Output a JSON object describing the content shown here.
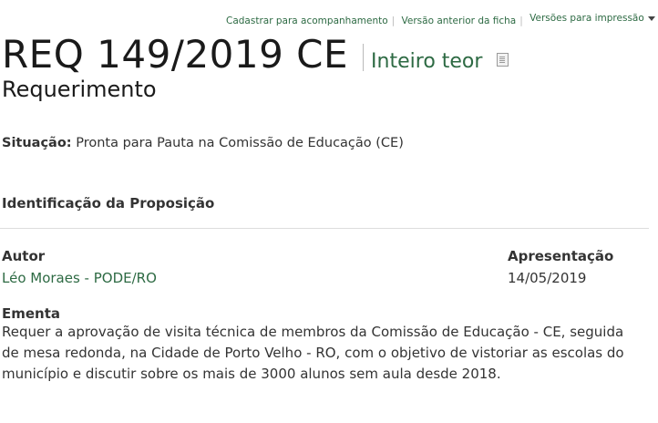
{
  "toplinks": {
    "cadastrar": "Cadastrar para acompanhamento",
    "versao_anterior": "Versão anterior da ficha",
    "versoes_impressao": "Versões para impressão"
  },
  "header": {
    "title": "REQ 149/2019 CE",
    "inteiro_teor": "Inteiro teor",
    "subtitle": "Requerimento"
  },
  "situacao": {
    "label": "Situação:",
    "value": "Pronta para Pauta na Comissão de Educação (CE)"
  },
  "identificacao": {
    "heading": "Identificação da Proposição"
  },
  "autor": {
    "label": "Autor",
    "value": "Léo Moraes - PODE/RO"
  },
  "apresentacao": {
    "label": "Apresentação",
    "value": "14/05/2019"
  },
  "ementa": {
    "label": "Ementa",
    "value": "Requer a aprovação de visita técnica de membros da Comissão de Educação - CE, seguida de mesa redonda, na Cidade de Porto Velho - RO, com o objetivo de vistoriar as escolas do município e discutir sobre os mais de 3000 alunos sem aula desde 2018."
  },
  "colors": {
    "link": "#2d6a43",
    "text": "#333333"
  },
  "icons": {
    "pdf": "pdf-icon",
    "dropdown": "caret-down-icon"
  }
}
